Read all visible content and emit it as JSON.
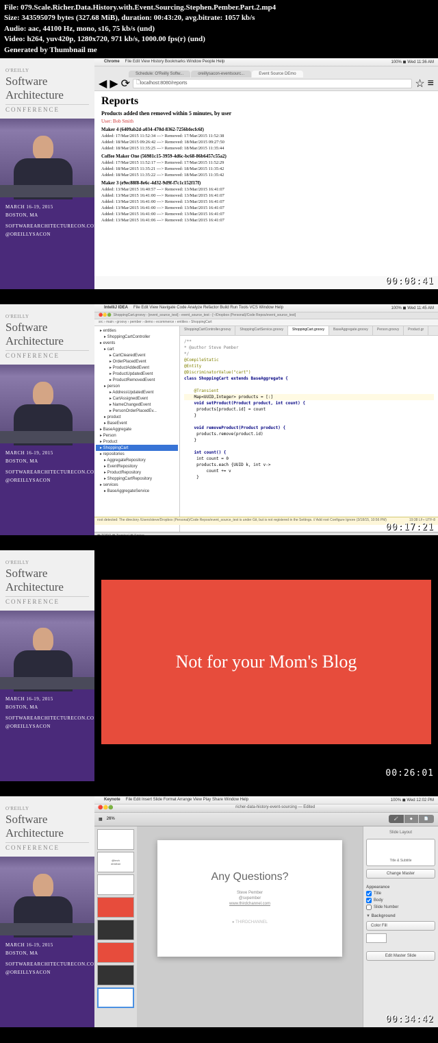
{
  "header": {
    "file_label": "File:",
    "file": "079.Scale.Richer.Data.History.with.Event.Sourcing.Stephen.Pember.Part.2.mp4",
    "size_label": "Size:",
    "size_bytes": "343595079",
    "size_unit": "bytes",
    "size_mib": "(327.68 MiB),",
    "duration_label": "duration:",
    "duration": "00:43:20,",
    "bitrate_label": "avg.bitrate:",
    "bitrate": "1057 kb/s",
    "audio_label": "Audio:",
    "audio": "aac, 44100 Hz, mono, s16, 75 kb/s (und)",
    "video_label": "Video:",
    "video": "h264, yuv420p, 1280x720, 971 kb/s, 1000.00 fps(r) (und)",
    "generated": "Generated by Thumbnail me"
  },
  "sidebar": {
    "oreilly": "O'REILLY",
    "title1": "Software",
    "title2": "Architecture",
    "conf": "CONFERENCE",
    "date": "MARCH 16-19, 2015",
    "city": "BOSTON, MA",
    "url": "SOFTWAREARCHITECTURECON.COM",
    "handle": "@OREILLYSACON"
  },
  "timestamps": [
    "00:08:41",
    "00:17:21",
    "00:26:01",
    "00:34:42"
  ],
  "thumb1": {
    "menubar": {
      "app": "Chrome",
      "items": [
        "File",
        "Edit",
        "View",
        "History",
        "Bookmarks",
        "Window",
        "People",
        "Help"
      ],
      "right": "100% ◼ Wed 11:36 AM"
    },
    "tabs": [
      "Schedule: O'Reilly Softw...",
      "oreillysacon-eventsourc...",
      "Event Source DEmo"
    ],
    "url": "localhost:8080/reports",
    "h1": "Reports",
    "subtitle": "Products added then removed within 5 minutes, by user",
    "user": "User: Bob Smith",
    "groups": [
      {
        "title": "Maker 4 (6409ab2d-a034-470d-8362-7256bfecfc6f)",
        "lines": [
          "Added: 17/Mar/2015 11:52:34 ---> Removed: 17/Mar/2015 11:52:38",
          "Added: 18/Mar/2015 09:26:42 ---> Removed: 18/Mar/2015 09:27:50",
          "Added: 18/Mar/2015 11:35:25 ---> Removed: 18/Mar/2015 11:35:44"
        ]
      },
      {
        "title": "Coffee Maker One (56981c15-3959-4d6c-bc68-86b6457c55a2)",
        "lines": [
          "Added: 17/Mar/2015 11:52:17 ---> Removed: 17/Mar/2015 11:52:29",
          "Added: 18/Mar/2015 11:35:21 ---> Removed: 18/Mar/2015 11:35:42",
          "Added: 18/Mar/2015 11:35:22 ---> Removed: 18/Mar/2015 11:35:42"
        ]
      },
      {
        "title": "Maker 3 (e9ec88f8-8e6c-4d32-9d9f-f7c1c152f17f)",
        "lines": [
          "Added: 13/Mar/2015 16:40:57 ---> Removed: 13/Mar/2015 16:41:07",
          "Added: 13/Mar/2015 16:41:00 ---> Removed: 13/Mar/2015 16:41:07",
          "Added: 13/Mar/2015 16:41:00 ---> Removed: 13/Mar/2015 16:41:07",
          "Added: 13/Mar/2015 16:41:00 ---> Removed: 13/Mar/2015 16:41:07",
          "Added: 13/Mar/2015 16:41:00 ---> Removed: 13/Mar/2015 16:41:07",
          "Added: 13/Mar/2015 16:41:06 ---> Removed: 13/Mar/2015 16:41:07"
        ]
      }
    ]
  },
  "thumb2": {
    "menubar": {
      "app": "IntelliJ IDEA",
      "items": [
        "File",
        "Edit",
        "View",
        "Navigate",
        "Code",
        "Analyze",
        "Refactor",
        "Build",
        "Run",
        "Tools",
        "VCS",
        "Window",
        "Help"
      ],
      "right": "100% ◼ Wed 11:45 AM"
    },
    "breadcrumb": "ShoppingCart.groovy - [event_source_test] - event_source_test - [~/Dropbox (Personal)/Code Repos/event_source_test]",
    "path": "src › main › groovy › pember › demo › ecommerce › entities › ShoppingCart",
    "tree": [
      {
        "t": "entities",
        "d": 0
      },
      {
        "t": "ShoppingCartController",
        "d": 1
      },
      {
        "t": "events",
        "d": 0
      },
      {
        "t": "cart",
        "d": 1
      },
      {
        "t": "CartClearedEvent",
        "d": 2
      },
      {
        "t": "OrderPlacedEvent",
        "d": 2
      },
      {
        "t": "ProductAddedEvent",
        "d": 2
      },
      {
        "t": "ProductUpdatedEvent",
        "d": 2
      },
      {
        "t": "ProductRemovedEvent",
        "d": 2
      },
      {
        "t": "person",
        "d": 1
      },
      {
        "t": "AddressUpdatedEvent",
        "d": 2
      },
      {
        "t": "CartAssignedEvent",
        "d": 2
      },
      {
        "t": "NameChangedEvent",
        "d": 2
      },
      {
        "t": "PersonOrderPlacedEv...",
        "d": 2
      },
      {
        "t": "product",
        "d": 1
      },
      {
        "t": "BaseEvent",
        "d": 1
      },
      {
        "t": "BaseAggregate",
        "d": 0
      },
      {
        "t": "Person",
        "d": 0
      },
      {
        "t": "Product",
        "d": 0
      },
      {
        "t": "ShoppingCart",
        "d": 0,
        "sel": true
      },
      {
        "t": "repositories",
        "d": 0
      },
      {
        "t": "AggregateRepository",
        "d": 1
      },
      {
        "t": "EventRepository",
        "d": 1
      },
      {
        "t": "ProductRepository",
        "d": 1
      },
      {
        "t": "ShoppingCartRepository",
        "d": 1
      },
      {
        "t": "services",
        "d": 0
      },
      {
        "t": "BaseAggregateService",
        "d": 1
      }
    ],
    "tabs": [
      "ShoppingCartController.groovy",
      "ShoppingCartService.groovy",
      "ShoppingCart.groovy",
      "BaseAggregate.groovy",
      "Person.groovy",
      "Product.gr"
    ],
    "active_tab": 2,
    "code": {
      "author": " * @author Steve Pember",
      "ann1": "@CompileStatic",
      "ann2": "@Entity",
      "ann3": "@DiscriminatorValue(\"cart\")",
      "cls": "class ShoppingCart extends BaseAggregate {",
      "ann4": "@Transient",
      "fld": "Map<UUID,Integer> products = [:]",
      "m1a": "void setProduct(Product product, int count) {",
      "m1b": "    products[product.id] = count",
      "m2a": "void removeProduct(Product product) {",
      "m2b": "    products.remove(product.id)",
      "m3a": "int count() {",
      "m3b": "    int count = 0",
      "m3c": "    products.each {UUID k, int v->",
      "m3d": "        count += v",
      "m3e": "    }"
    },
    "bottom_tabs": [
      "TODO",
      "Terminal",
      "Spring"
    ],
    "status": "root detected: The directory /Users/steve/Dropbox (Personal)/Code Repos/event_source_test is under Git, but is not registered in the Settings. // Add root  Configure  Ignore (3/18/15, 10:56 PM)",
    "status_right": "19:38  LF÷  UTF-8"
  },
  "thumb3": {
    "text": "Not for your Mom's Blog"
  },
  "thumb4": {
    "menubar": {
      "app": "Keynote",
      "items": [
        "File",
        "Edit",
        "Insert",
        "Slide",
        "Format",
        "Arrange",
        "View",
        "Play",
        "Share",
        "Window",
        "Help"
      ],
      "right": "100% ◼ Wed 12:02 PM"
    },
    "doc_title": "richer-data-history-event-sourcing — Edited",
    "zoom": "26%",
    "slide": {
      "title": "Any Questions?",
      "name": "Steve Pember",
      "handle": "@svpember",
      "url": "www.thirdchannel.com",
      "footer": "THIRDCHANNEL"
    },
    "inspector": {
      "tabs": [
        "Format",
        "Animate",
        "Document"
      ],
      "section1": "Slide Layout",
      "layout": "Title & Subtitle",
      "change_master": "Change Master",
      "section2": "Appearance",
      "check_title": "Title",
      "check_body": "Body",
      "check_number": "Slide Number",
      "section3": "Background",
      "bg_type": "Color Fill",
      "edit_master": "Edit Master Slide"
    }
  }
}
